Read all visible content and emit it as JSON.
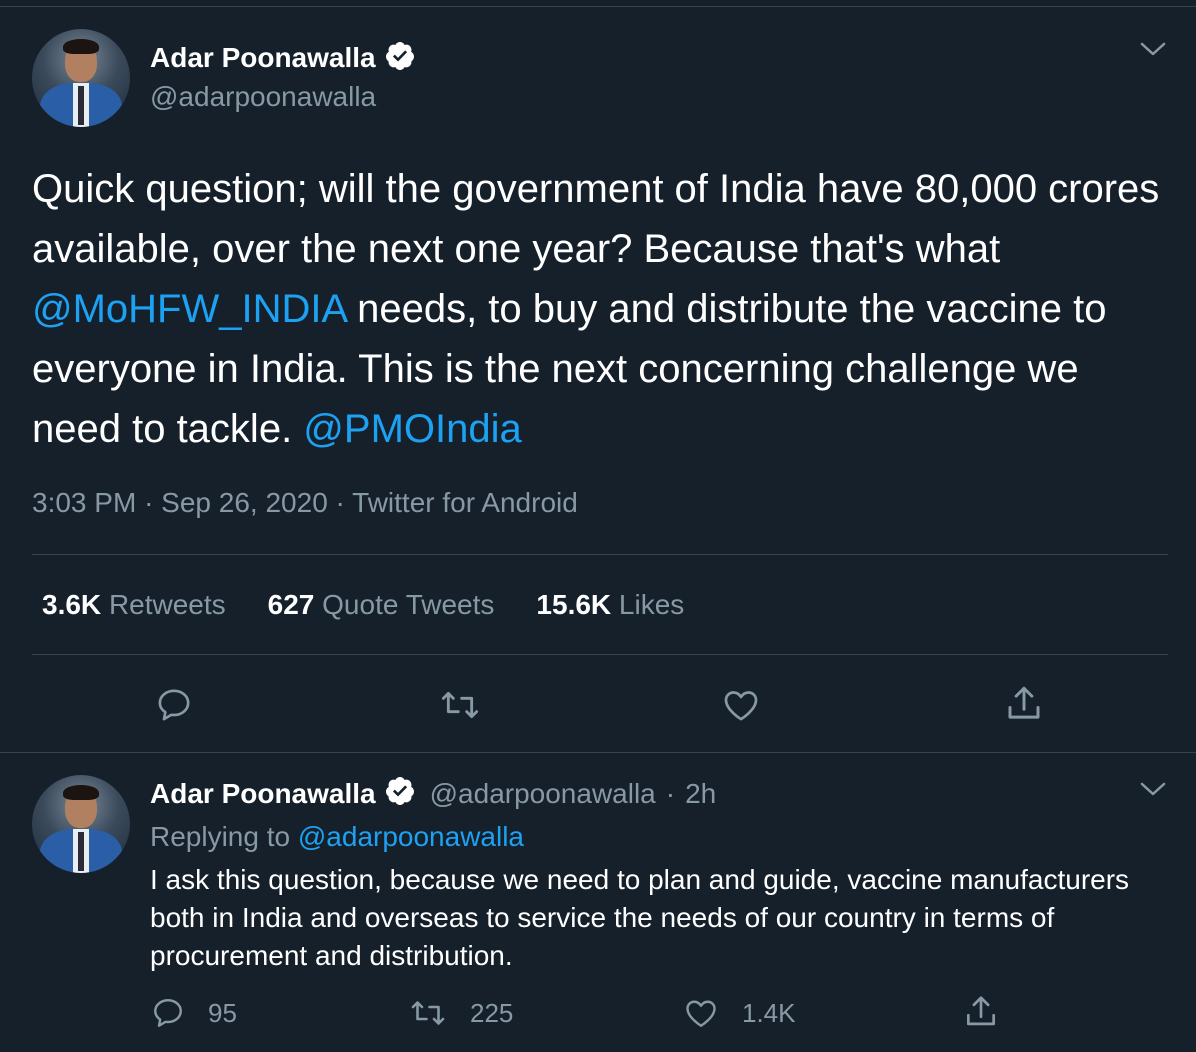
{
  "main_tweet": {
    "author": {
      "display_name": "Adar Poonawalla",
      "handle": "@adarpoonawalla",
      "verified_icon": "verified-badge-icon"
    },
    "text_part1": "Quick question; will the government of India have 80,000 crores available, over the next one year? Because that's what ",
    "mention1": "@MoHFW_INDIA",
    "text_part2": " needs, to buy and distribute the vaccine to everyone in India. This is the next concerning challenge we need to tackle.  ",
    "mention2": "@PMOIndia",
    "time": "3:03 PM",
    "date": "Sep 26, 2020",
    "source": "Twitter for Android",
    "stats": {
      "retweets_count": "3.6K",
      "retweets_label": "Retweets",
      "quotes_count": "627",
      "quotes_label": "Quote Tweets",
      "likes_count": "15.6K",
      "likes_label": "Likes"
    }
  },
  "reply_tweet": {
    "author": {
      "display_name": "Adar Poonawalla",
      "handle": "@adarpoonawalla",
      "time_ago": "2h"
    },
    "replying_prefix": "Replying to ",
    "replying_to": "@adarpoonawalla",
    "text": "I ask this question, because we need to plan and guide, vaccine manufacturers both in India and overseas to service the needs of our country in terms of procurement and distribution.",
    "counts": {
      "replies": "95",
      "retweets": "225",
      "likes": "1.4K"
    }
  },
  "separator": "·",
  "colors": {
    "background": "#15202b",
    "text": "#ffffff",
    "secondary": "#8899a6",
    "accent": "#1da1f2",
    "divider": "#38444d"
  }
}
